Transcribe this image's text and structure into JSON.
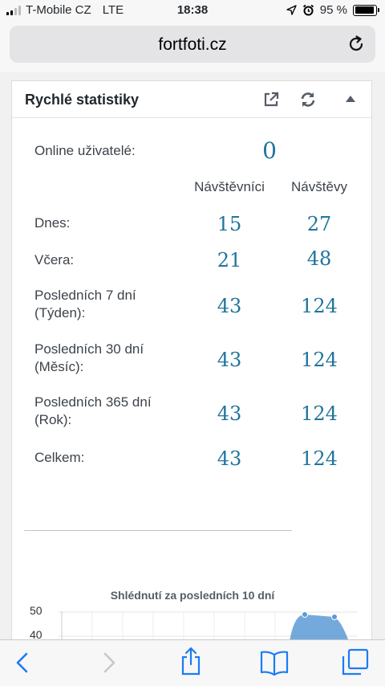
{
  "status_bar": {
    "carrier": "T-Mobile CZ",
    "network": "LTE",
    "time": "18:38",
    "battery": "95 %",
    "battery_level": 0.95
  },
  "browser": {
    "url": "fortfoti.cz"
  },
  "widget": {
    "title": "Rychlé statistiky",
    "online_label": "Online uživatelé:",
    "online_value": "0",
    "columns": [
      "Návštěvníci",
      "Návštěvy"
    ],
    "rows": [
      {
        "label": "Dnes:",
        "visitors": "15",
        "visits": "27"
      },
      {
        "label": "Včera:",
        "visitors": "21",
        "visits": "48"
      },
      {
        "label": "Posledních 7 dní (Týden):",
        "visitors": "43",
        "visits": "124"
      },
      {
        "label": "Posledních 30 dní (Měsíc):",
        "visitors": "43",
        "visits": "124"
      },
      {
        "label": "Posledních 365 dní (Rok):",
        "visitors": "43",
        "visits": "124"
      },
      {
        "label": "Celkem:",
        "visitors": "43",
        "visits": "124"
      }
    ],
    "chart": {
      "title": "Shlédnutí za posledních 10 dní",
      "y_ticks": [
        "50",
        "40"
      ],
      "color": "#5b9bd5"
    }
  },
  "accent_color": "#21759b",
  "icons": [
    "external-link-icon",
    "refresh-icon",
    "collapse-arrow-icon",
    "back-icon",
    "forward-icon",
    "share-icon",
    "bookmarks-icon",
    "tabs-icon"
  ]
}
